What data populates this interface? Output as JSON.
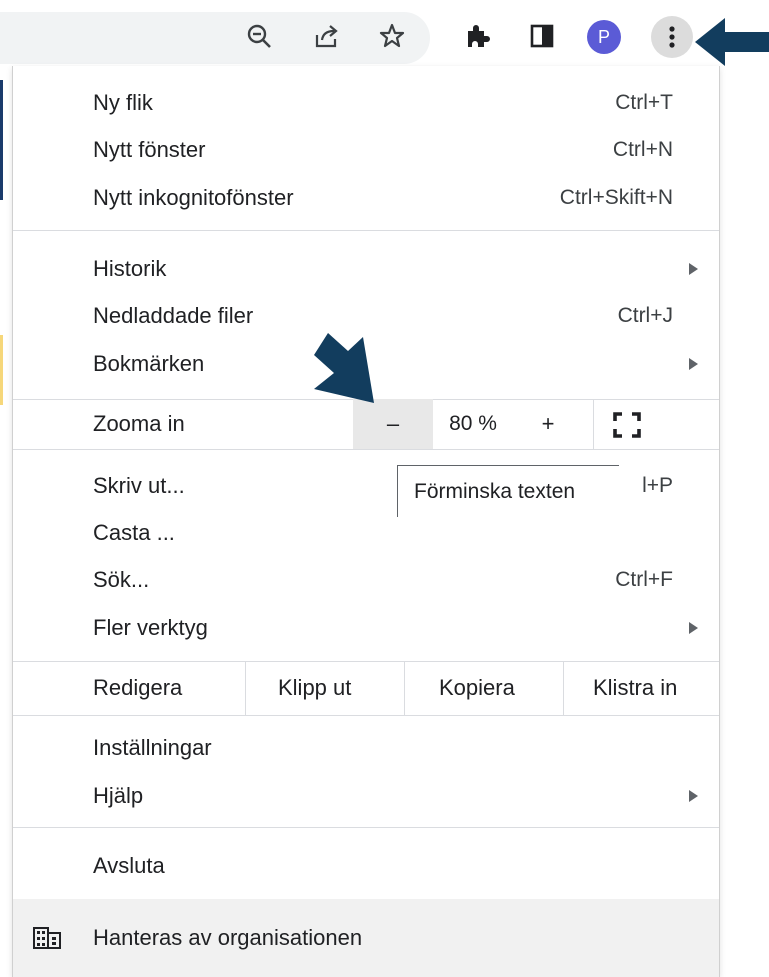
{
  "toolbar": {
    "icons": [
      "zoom-out-icon",
      "share-icon",
      "star-icon",
      "extensions-icon",
      "side-panel-icon",
      "avatar",
      "kebab-menu-icon"
    ],
    "avatar_letter": "P",
    "accent_color": "#5b5bd6"
  },
  "menu": {
    "group1": [
      {
        "label": "Ny flik",
        "shortcut": "Ctrl+T"
      },
      {
        "label": "Nytt fönster",
        "shortcut": "Ctrl+N"
      },
      {
        "label": "Nytt inkognitofönster",
        "shortcut": "Ctrl+Skift+N"
      }
    ],
    "group2": [
      {
        "label": "Historik",
        "shortcut": ""
      },
      {
        "label": "Nedladdade filer",
        "shortcut": "Ctrl+J"
      },
      {
        "label": "Bokmärken",
        "shortcut": ""
      }
    ],
    "zoom": {
      "label": "Zooma in",
      "minus": "–",
      "value": "80 %",
      "plus": "+"
    },
    "group3": [
      {
        "label": "Skriv ut...",
        "shortcut": "l+P"
      },
      {
        "label": "Casta ...",
        "shortcut": ""
      },
      {
        "label": "Sök...",
        "shortcut": "Ctrl+F"
      },
      {
        "label": "Fler verktyg",
        "shortcut": ""
      }
    ],
    "edit": {
      "label": "Redigera",
      "cut": "Klipp ut",
      "copy": "Kopiera",
      "paste": "Klistra in"
    },
    "group4": [
      {
        "label": "Inställningar",
        "shortcut": ""
      },
      {
        "label": "Hjälp",
        "shortcut": ""
      }
    ],
    "exit": "Avsluta",
    "managed": "Hanteras av organisationen"
  },
  "tooltip": "Förminska texten"
}
